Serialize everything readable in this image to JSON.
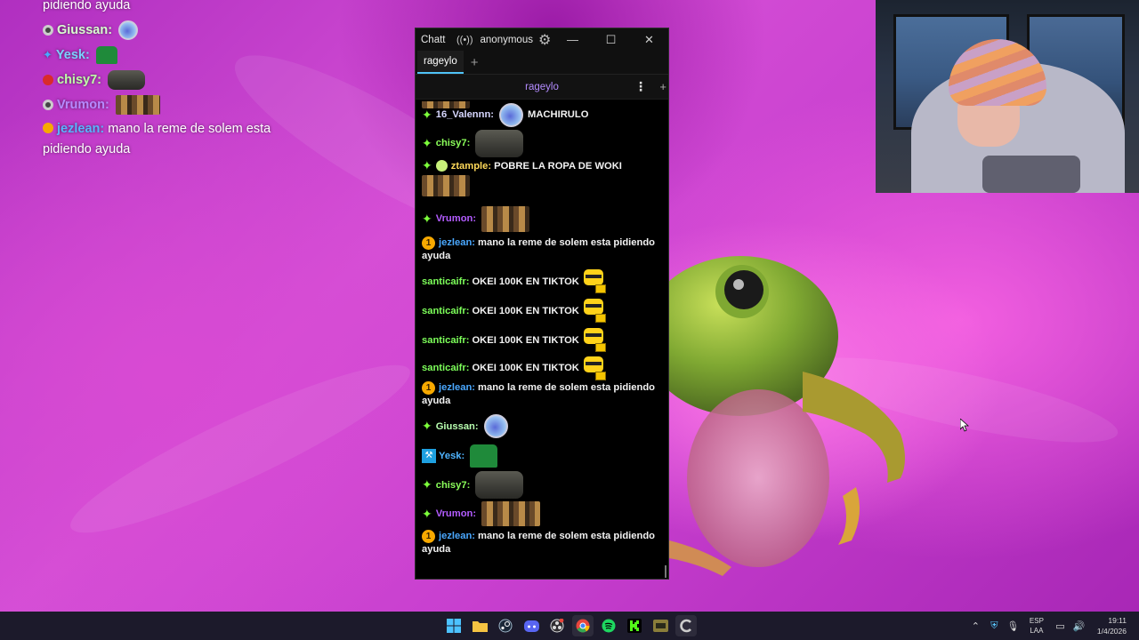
{
  "desktop_overlay": {
    "lines": [
      {
        "user": "",
        "text": "pidiendo ayuda",
        "user_color": "#ffffff",
        "badge": "none",
        "emote": "none"
      },
      {
        "user": "Giussan:",
        "text": "",
        "user_color": "#d9ffd0",
        "badge": "circle-gray",
        "emote": "bubble"
      },
      {
        "user": "Yesk:",
        "text": "",
        "user_color": "#7bd2ff",
        "badge": "sword-blue",
        "emote": "pepe"
      },
      {
        "user": "chisy7:",
        "text": "",
        "user_color": "#bfffa8",
        "badge": "circle-red",
        "emote": "cat"
      },
      {
        "user": "Vrumon:",
        "text": "",
        "user_color": "#b68aff",
        "badge": "circle-gray",
        "emote": "minions"
      },
      {
        "user": "jezlean:",
        "text": "mano la reme de solem esta pidiendo ayuda",
        "user_color": "#5ab3ff",
        "badge": "sub-1",
        "emote": "none"
      }
    ]
  },
  "chat_window": {
    "title": "Chatterino",
    "account": "anonymous",
    "tabs": [
      "rageylo"
    ],
    "channel": "rageylo",
    "messages": [
      {
        "badge": "sub",
        "user": "16_Valennn:",
        "user_color": "#d7d7ff",
        "text": "MACHIRULO",
        "emote": "bubble",
        "emote_before_text": true
      },
      {
        "badge": "sub",
        "user": "chisy7:",
        "user_color": "#8bff5a",
        "text": "",
        "emote": "cat"
      },
      {
        "badge": "sub",
        "badge2": "bug",
        "user": "ztample:",
        "user_color": "#ffd95a",
        "text": "POBRE LA ROPA DE WOKI",
        "emote": "minions",
        "emote_next_line": true
      },
      {
        "badge": "sub",
        "user": "Vrumon:",
        "user_color": "#b35cff",
        "text": "",
        "emote": "minions"
      },
      {
        "badge": "one",
        "user": "jezlean:",
        "user_color": "#4aa8ff",
        "text": "mano la reme de solem esta pidiendo ayuda",
        "emote": "none"
      },
      {
        "badge": "none",
        "user": "santicaifr:",
        "user_color": "#7dff5a",
        "text": "OKEI 100K EN TIKTOK",
        "emote": "yellow"
      },
      {
        "badge": "none",
        "user": "santicaifr:",
        "user_color": "#7dff5a",
        "text": "OKEI 100K EN TIKTOK",
        "emote": "yellow"
      },
      {
        "badge": "none",
        "user": "santicaifr:",
        "user_color": "#7dff5a",
        "text": "OKEI 100K EN TIKTOK",
        "emote": "yellow"
      },
      {
        "badge": "none",
        "user": "santicaifr:",
        "user_color": "#7dff5a",
        "text": "OKEI 100K EN TIKTOK",
        "emote": "yellow"
      },
      {
        "badge": "one",
        "user": "jezlean:",
        "user_color": "#4aa8ff",
        "text": "mano la reme de solem esta pidiendo ayuda",
        "emote": "none"
      },
      {
        "badge": "sub",
        "user": "Giussan:",
        "user_color": "#b8ffb0",
        "text": "",
        "emote": "bubble"
      },
      {
        "badge": "hammer",
        "user": "Yesk:",
        "user_color": "#4fb4ff",
        "text": "",
        "emote": "pepe"
      },
      {
        "badge": "sub",
        "user": "chisy7:",
        "user_color": "#8bff5a",
        "text": "",
        "emote": "cat"
      },
      {
        "badge": "sub",
        "user": "Vrumon:",
        "user_color": "#b35cff",
        "text": "",
        "emote": "minions-wide"
      },
      {
        "badge": "one",
        "user": "jezlean:",
        "user_color": "#4aa8ff",
        "text": "mano la reme de solem esta pidiendo ayuda",
        "emote": "none"
      }
    ]
  },
  "taskbar": {
    "apps": [
      "windows-start-icon",
      "file-explorer-icon",
      "steam-icon",
      "discord-icon",
      "obs-icon",
      "chrome-icon",
      "spotify-icon",
      "kick-icon",
      "game-icon",
      "chatterino-icon"
    ],
    "language": {
      "line1": "ESP",
      "line2": "LAA"
    },
    "time": "19:11",
    "date": "1/4/2026"
  },
  "colors": {
    "chat_background": "#000000",
    "tab_accent": "#4fc3f7",
    "sub_badge": "#7dff3b",
    "taskbar": "#1c1a2b"
  }
}
